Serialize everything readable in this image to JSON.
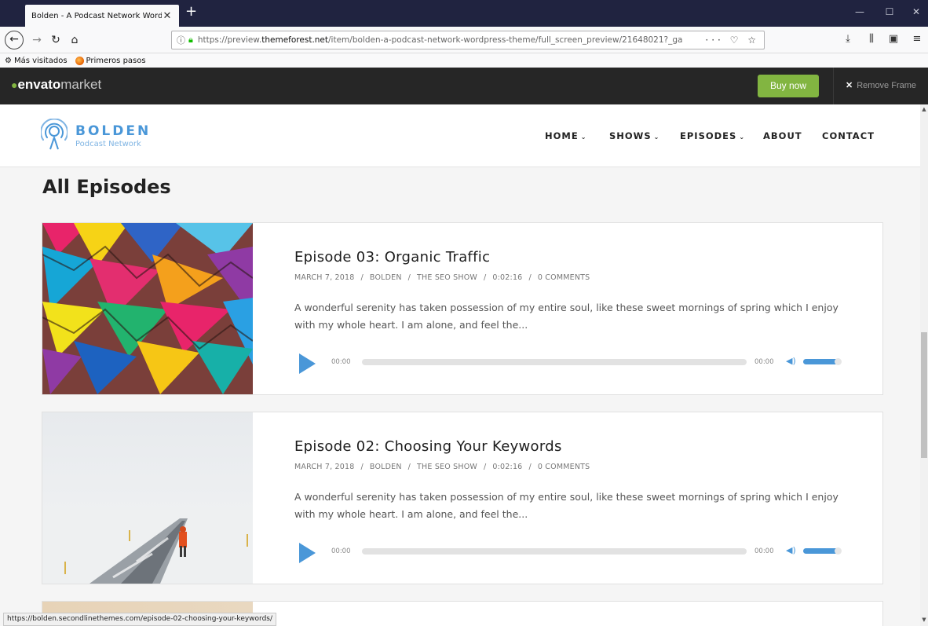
{
  "browser": {
    "tab_title": "Bolden - A Podcast Network WordP",
    "tab_close": "✕",
    "new_tab": "+",
    "url_host_prefix": "https://preview.",
    "url_host": "themeforest.net",
    "url_path": "/item/bolden-a-podcast-network-wordpress-theme/full_screen_preview/21648021?_ga",
    "url_actions": "··· ♡ ☆",
    "bookmarks": [
      "Más visitados",
      "Primeros pasos"
    ],
    "status_url": "https://bolden.secondlinethemes.com/episode-02-choosing-your-keywords/"
  },
  "envato": {
    "logo_env": "envato",
    "logo_market": "market",
    "buy_label": "Buy now",
    "remove_label": "Remove Frame"
  },
  "site": {
    "logo_name": "BOLDEN",
    "logo_sub": "Podcast Network",
    "nav": [
      {
        "label": "HOME",
        "has_caret": true
      },
      {
        "label": "SHOWS",
        "has_caret": true
      },
      {
        "label": "EPISODES",
        "has_caret": true
      },
      {
        "label": "ABOUT",
        "has_caret": false
      },
      {
        "label": "CONTACT",
        "has_caret": false
      }
    ],
    "caret": "⌄"
  },
  "page_title": "All Episodes",
  "episodes": [
    {
      "title": "Episode 03: Organic Traffic",
      "date": "MARCH 7, 2018",
      "author": "BOLDEN",
      "show": "THE SEO SHOW",
      "duration": "0:02:16",
      "comments": "0 COMMENTS",
      "description": "A wonderful serenity has taken possession of my entire soul, like these sweet mornings of spring which I enjoy with my whole heart. I am alone, and feel the...",
      "time_current": "00:00",
      "time_total": "00:00"
    },
    {
      "title": "Episode 02: Choosing Your Keywords",
      "date": "MARCH 7, 2018",
      "author": "BOLDEN",
      "show": "THE SEO SHOW",
      "duration": "0:02:16",
      "comments": "0 COMMENTS",
      "description": "A wonderful serenity has taken possession of my entire soul, like these sweet mornings of spring which I enjoy with my whole heart. I am alone, and feel the...",
      "time_current": "00:00",
      "time_total": "00:00"
    }
  ],
  "meta_separator": "/",
  "colors": {
    "brand_blue": "#4a97d8",
    "envato_green": "#82b541",
    "envato_bar": "#262626"
  },
  "icons": {
    "back": "back-arrow-icon",
    "forward": "forward-arrow-icon",
    "reload": "reload-icon",
    "home": "home-icon",
    "info": "info-icon",
    "lock": "lock-icon",
    "download": "download-icon",
    "library": "library-icon",
    "sidebar": "sidebar-icon",
    "menu": "hamburger-menu-icon",
    "play": "play-icon",
    "volume": "volume-icon",
    "close": "close-icon"
  }
}
